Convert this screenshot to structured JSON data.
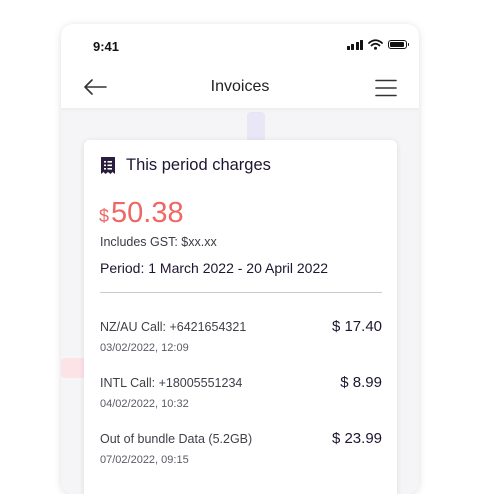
{
  "status_bar": {
    "time": "9:41"
  },
  "nav": {
    "title": "Invoices"
  },
  "card": {
    "title": "This period charges",
    "currency_symbol": "$",
    "amount": "50.38",
    "gst_note": "Includes GST: $xx.xx",
    "period": "Period: 1 March 2022 - 20 April 2022",
    "charges": [
      {
        "description": "NZ/AU Call: +6421654321",
        "date": "03/02/2022, 12:09",
        "amount": "$ 17.40"
      },
      {
        "description": "INTL Call: +18005551234",
        "date": "04/02/2022, 10:32",
        "amount": "$ 8.99"
      },
      {
        "description": "Out of bundle Data (5.2GB)",
        "date": "07/02/2022, 09:15",
        "amount": "$ 23.99"
      }
    ]
  },
  "colors": {
    "accent": "#ef6663",
    "text_dark": "#1e1530"
  },
  "icons": [
    "signal-icon",
    "wifi-icon",
    "battery-icon",
    "back-arrow-icon",
    "hamburger-menu-icon",
    "receipt-icon"
  ]
}
